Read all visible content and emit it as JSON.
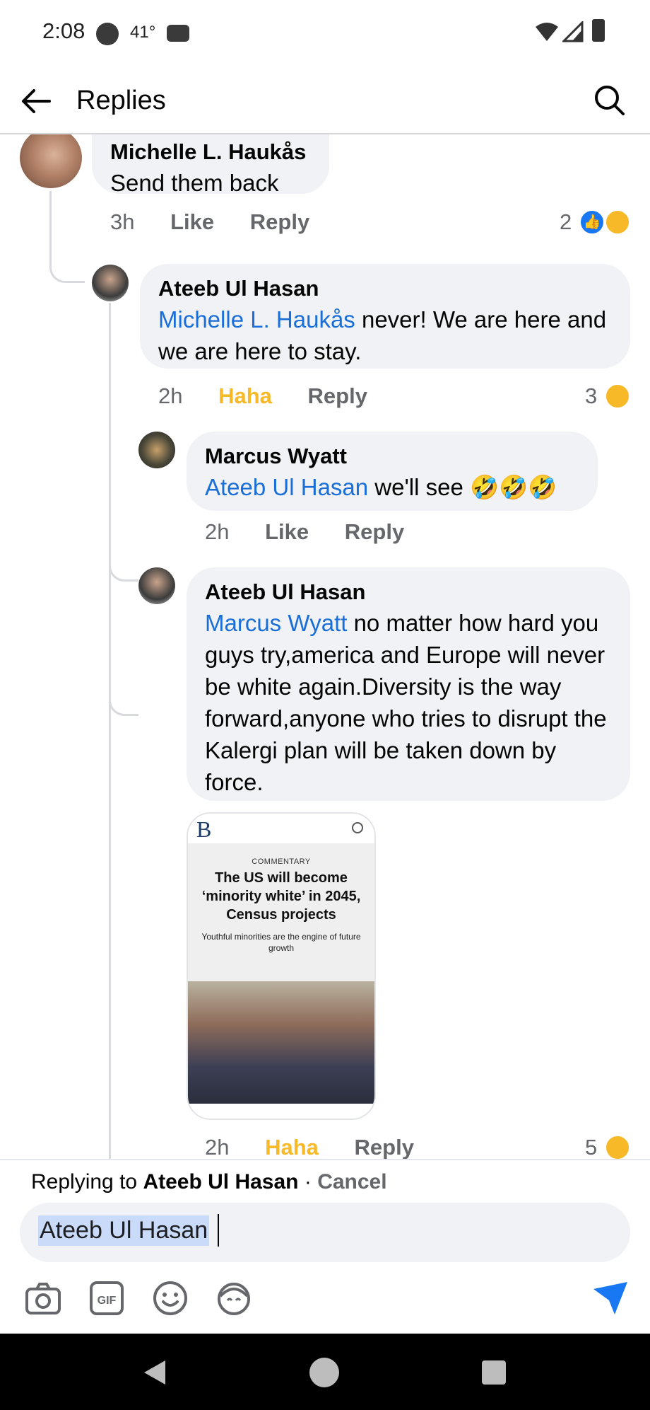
{
  "status_bar": {
    "time": "2:08",
    "temperature": "41°"
  },
  "header": {
    "title": "Replies"
  },
  "comments": [
    {
      "author": "Michelle L. Haukås",
      "text": "Send them back",
      "time": "3h",
      "like": "Like",
      "reply": "Reply",
      "reaction_count": "2"
    },
    {
      "author": "Ateeb Ul Hasan",
      "mention": "Michelle L. Haukås",
      "text": " never! We are here and we are here to stay.",
      "time": "2h",
      "like": "Haha",
      "reply": "Reply",
      "reaction_count": "3"
    },
    {
      "author": "Marcus Wyatt",
      "mention": "Ateeb Ul Hasan",
      "text": " we'll see 🤣🤣🤣",
      "time": "2h",
      "like": "Like",
      "reply": "Reply"
    },
    {
      "author": "Ateeb Ul Hasan",
      "mention": "Marcus Wyatt",
      "text": " no matter how hard you guys try,america and Europe will never be white again.Diversity is the way forward,anyone who tries to disrupt the Kalergi plan will be taken down by force.",
      "time": "2h",
      "like": "Haha",
      "reply": "Reply",
      "reaction_count": "5"
    }
  ],
  "article": {
    "logo": "B",
    "kicker": "COMMENTARY",
    "title": "The US will become ‘minority white’ in 2045, Census projects",
    "subtitle": "Youthful minorities are the engine of future growth"
  },
  "reply_bar": {
    "replying_prefix": "Replying to ",
    "replying_name": "Ateeb Ul Hasan",
    "separator": " · ",
    "cancel": "Cancel",
    "input_value": "Ateeb Ul Hasan"
  },
  "colors": {
    "accent": "#1877f2",
    "mention": "#1a6ed8",
    "haha": "#f7b928",
    "bubble": "#f0f2f5"
  },
  "icons": [
    "back-arrow-icon",
    "search-icon",
    "camera-icon",
    "gif-icon",
    "emoji-icon",
    "avatar-sticker-icon",
    "send-icon"
  ]
}
